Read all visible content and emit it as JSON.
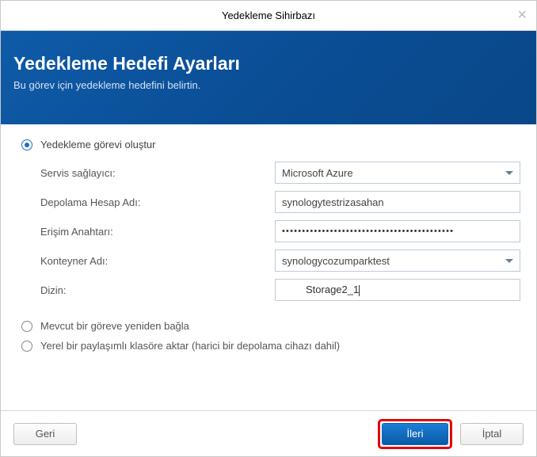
{
  "titlebar": {
    "title": "Yedekleme Sihirbazı",
    "close": "×"
  },
  "header": {
    "title": "Yedekleme Hedefi Ayarları",
    "subtitle": "Bu görev için yedekleme hedefini belirtin."
  },
  "form": {
    "radio_create": "Yedekleme görevi oluştur",
    "radio_rebind": "Mevcut bir göreve yeniden bağla",
    "radio_local": "Yerel bir paylaşımlı klasöre aktar (harici bir depolama cihazı dahil)",
    "labels": {
      "provider": "Servis sağlayıcı:",
      "account": "Depolama Hesap Adı:",
      "key": "Erişim Anahtarı:",
      "container": "Konteyner Adı:",
      "dir": "Dizin:"
    },
    "values": {
      "provider": "Microsoft Azure",
      "account": "synologytestrizasahan",
      "key_masked": "•••••••••••••••••••••••••••••••••••••••••••",
      "container": "synologycozumparktest",
      "dir": "Storage2_1"
    }
  },
  "footer": {
    "back": "Geri",
    "next": "İleri",
    "cancel": "İptal"
  }
}
